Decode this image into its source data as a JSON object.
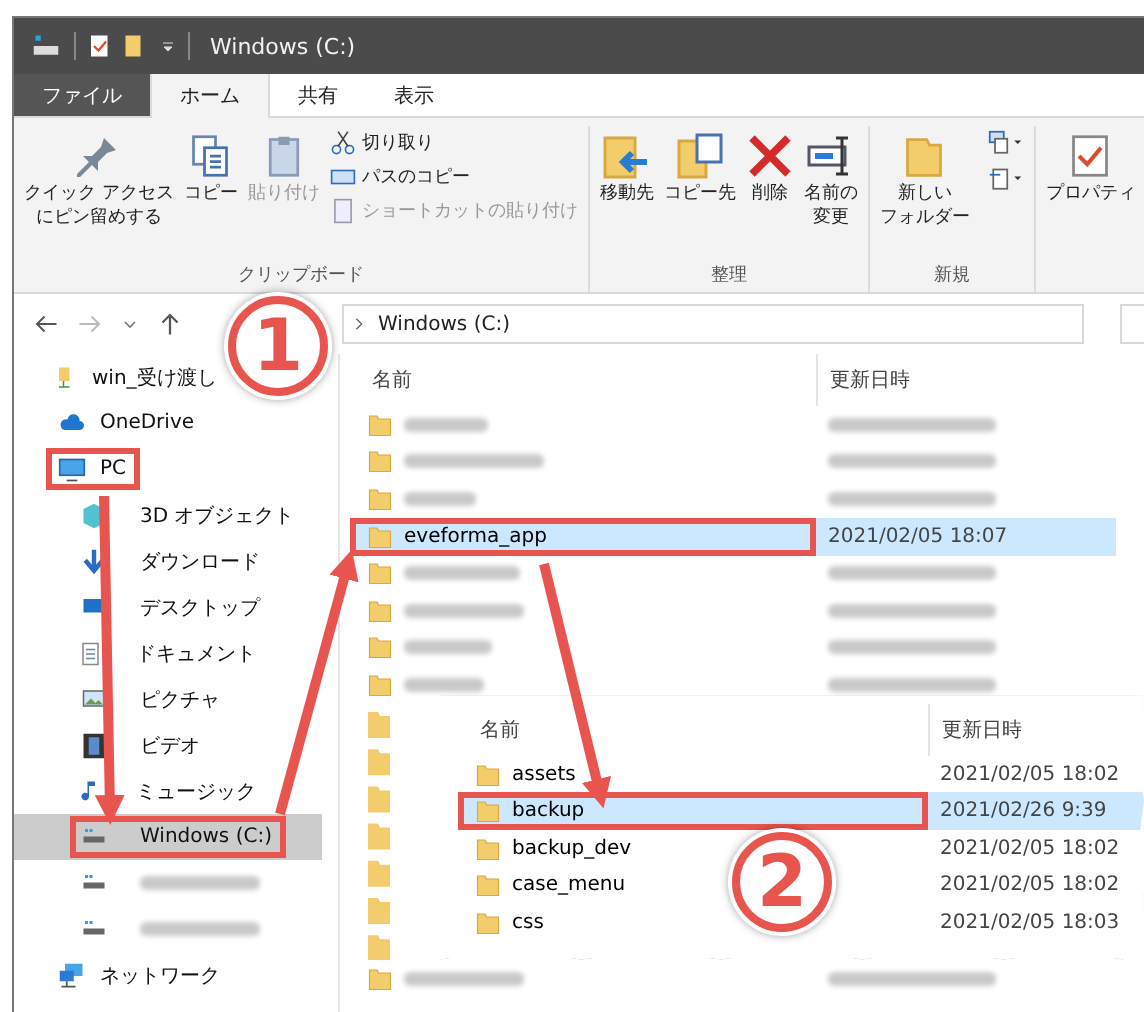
{
  "window": {
    "title": "Windows (C:)"
  },
  "ribbon_tabs": [
    {
      "label": "ファイル",
      "kind": "file",
      "selected": false
    },
    {
      "label": "ホーム",
      "kind": "tab",
      "selected": true
    },
    {
      "label": "共有",
      "kind": "tab",
      "selected": false
    },
    {
      "label": "表示",
      "kind": "tab",
      "selected": false
    }
  ],
  "ribbon_groups": [
    {
      "label": "クリップボード",
      "buttons": [
        {
          "lines": [
            "クイック アクセス",
            "にピン留めする"
          ],
          "kind": "pin",
          "disabled": false
        },
        {
          "lines": [
            "コピー"
          ],
          "kind": "copy",
          "disabled": false
        },
        {
          "lines": [
            "貼り付け"
          ],
          "kind": "paste",
          "disabled": true
        }
      ],
      "small_buttons": [
        {
          "label": "切り取り",
          "kind": "cut",
          "disabled": false
        },
        {
          "label": "パスのコピー",
          "kind": "path",
          "disabled": false
        },
        {
          "label": "ショートカットの貼り付け",
          "kind": "shortcut",
          "disabled": true
        }
      ]
    },
    {
      "label": "整理",
      "buttons": [
        {
          "lines": [
            "移動先"
          ],
          "kind": "move",
          "disabled": false
        },
        {
          "lines": [
            "コピー先"
          ],
          "kind": "copyto",
          "disabled": false
        },
        {
          "lines": [
            "削除"
          ],
          "kind": "delete",
          "disabled": false
        },
        {
          "lines": [
            "名前の",
            "変更"
          ],
          "kind": "rename",
          "disabled": false
        }
      ]
    },
    {
      "label": "新規",
      "buttons": [
        {
          "lines": [
            "新しい",
            "フォルダー"
          ],
          "kind": "folder",
          "disabled": false
        }
      ],
      "small_buttons": [
        {
          "kind": "newitem"
        },
        {
          "kind": "easyaccess"
        }
      ]
    },
    {
      "buttons": [
        {
          "lines": [
            "プロパティ"
          ],
          "kind": "props",
          "disabled": false
        }
      ]
    }
  ],
  "address": {
    "crumbs": [
      "Windows (C:)"
    ]
  },
  "sidebar": [
    {
      "label": "win_受け渡し",
      "kind": "share",
      "selected": false,
      "boxed": false
    },
    {
      "label": "OneDrive",
      "kind": "cloud",
      "selected": false,
      "boxed": false
    },
    {
      "label": "PC",
      "kind": "pc",
      "selected": false,
      "boxed": true,
      "children": [
        {
          "label": "3D オブジェクト",
          "kind": "cube",
          "selected": false,
          "boxed": false
        },
        {
          "label": "ダウンロード",
          "kind": "download",
          "selected": false,
          "boxed": false
        },
        {
          "label": "デスクトップ",
          "kind": "desktop",
          "selected": false,
          "boxed": false
        },
        {
          "label": "ドキュメント",
          "kind": "doc",
          "selected": false,
          "boxed": false
        },
        {
          "label": "ピクチャ",
          "kind": "picture",
          "selected": false,
          "boxed": false
        },
        {
          "label": "ビデオ",
          "kind": "video",
          "selected": false,
          "boxed": false
        },
        {
          "label": "ミュージック",
          "kind": "music",
          "selected": false,
          "boxed": false
        },
        {
          "label": "Windows (C:)",
          "kind": "drive",
          "selected": true,
          "boxed": true
        },
        {
          "kind": "blurred-drive",
          "selected": false,
          "boxed": false
        },
        {
          "kind": "blurred-drive",
          "selected": false,
          "boxed": false
        }
      ]
    },
    {
      "label": "ネットワーク",
      "kind": "network",
      "selected": false,
      "boxed": false
    }
  ],
  "file_list": {
    "columns": [
      "名前",
      "更新日時"
    ],
    "rows": [
      {
        "kind": "blurred"
      },
      {
        "kind": "blurred"
      },
      {
        "kind": "blurred"
      },
      {
        "kind": "file",
        "name": "eveforma_app",
        "date": "2021/02/05 18:07",
        "selected": true,
        "boxed": true
      },
      {
        "kind": "blurred"
      },
      {
        "kind": "blurred"
      },
      {
        "kind": "blurred"
      },
      {
        "kind": "blurred"
      }
    ],
    "last_row": {
      "kind": "blurred"
    }
  },
  "inset": {
    "columns": [
      "名前",
      "更新日時"
    ],
    "rows": [
      {
        "name": "assets",
        "date": "2021/02/05 18:02",
        "selected": false,
        "boxed": false
      },
      {
        "name": "backup",
        "date": "2021/02/26 9:39",
        "selected": true,
        "boxed": true
      },
      {
        "name": "backup_dev",
        "date": "2021/02/05 18:02",
        "selected": false,
        "boxed": false
      },
      {
        "name": "case_menu",
        "date": "2021/02/05 18:02",
        "selected": false,
        "boxed": false
      },
      {
        "name": "css",
        "date": "2021/02/05 18:03",
        "selected": false,
        "boxed": false
      }
    ]
  },
  "step_badges": [
    {
      "label": "1"
    },
    {
      "label": "2"
    }
  ]
}
